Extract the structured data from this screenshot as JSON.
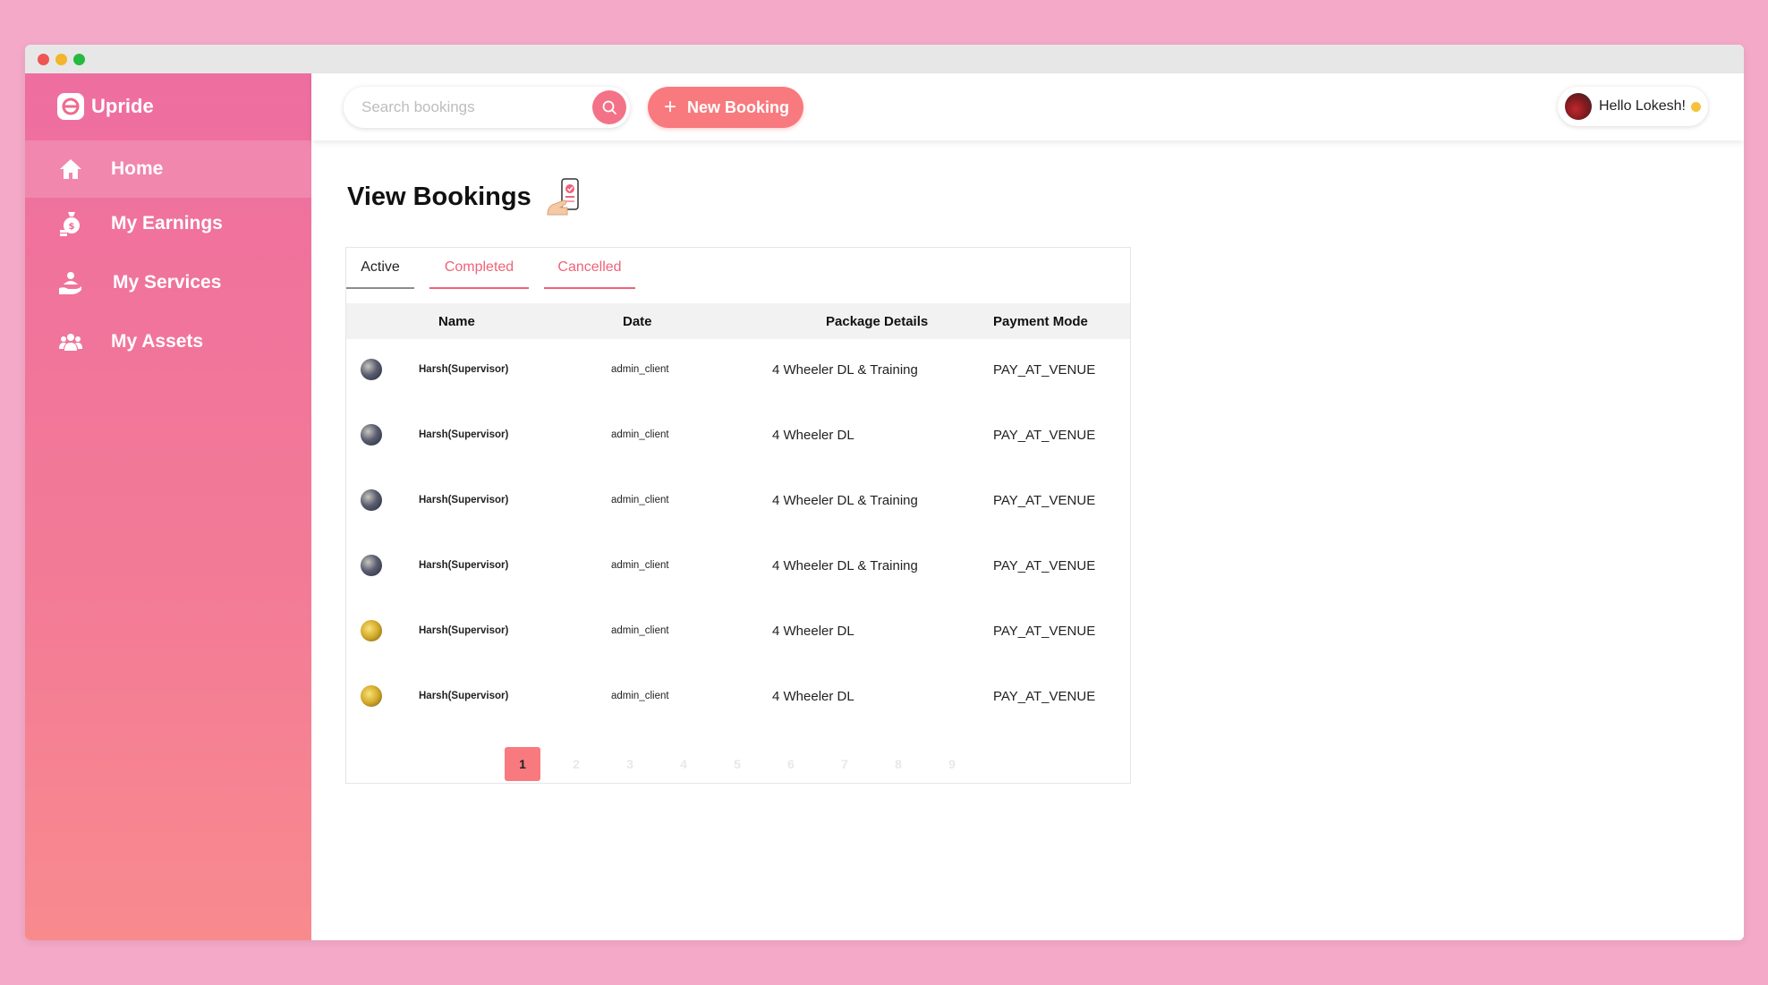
{
  "app": {
    "brand": "Upride"
  },
  "sidebar": {
    "items": [
      {
        "label": "Home",
        "icon": "home-icon",
        "active": true
      },
      {
        "label": "My Earnings",
        "icon": "money-bag-icon",
        "active": false
      },
      {
        "label": "My Services",
        "icon": "hand-service-icon",
        "active": false
      },
      {
        "label": "My Assets",
        "icon": "group-icon",
        "active": false
      }
    ]
  },
  "topbar": {
    "search_placeholder": "Search bookings",
    "new_booking_label": "New Booking",
    "greeting": "Hello Lokesh!"
  },
  "page": {
    "title": "View Bookings"
  },
  "tabs": [
    {
      "label": "Active",
      "active": true
    },
    {
      "label": "Completed",
      "active": false
    },
    {
      "label": "Cancelled",
      "active": false
    }
  ],
  "table": {
    "columns": [
      "Name",
      "Date",
      "Package Details",
      "Payment Mode"
    ],
    "rows": [
      {
        "avatar": "dark",
        "name": "Harsh(Supervisor)",
        "date": "admin_client",
        "package": "4 Wheeler DL & Training",
        "payment": "PAY_AT_VENUE"
      },
      {
        "avatar": "dark",
        "name": "Harsh(Supervisor)",
        "date": "admin_client",
        "package": "4 Wheeler DL",
        "payment": "PAY_AT_VENUE"
      },
      {
        "avatar": "dark",
        "name": "Harsh(Supervisor)",
        "date": "admin_client",
        "package": "4 Wheeler DL & Training",
        "payment": "PAY_AT_VENUE"
      },
      {
        "avatar": "dark",
        "name": "Harsh(Supervisor)",
        "date": "admin_client",
        "package": "4 Wheeler DL & Training",
        "payment": "PAY_AT_VENUE"
      },
      {
        "avatar": "gold",
        "name": "Harsh(Supervisor)",
        "date": "admin_client",
        "package": "4 Wheeler DL",
        "payment": "PAY_AT_VENUE"
      },
      {
        "avatar": "gold",
        "name": "Harsh(Supervisor)",
        "date": "admin_client",
        "package": "4 Wheeler DL",
        "payment": "PAY_AT_VENUE"
      }
    ]
  },
  "pagination": {
    "pages": [
      "1",
      "2",
      "3",
      "4",
      "5",
      "6",
      "7",
      "8",
      "9"
    ],
    "current": "1"
  },
  "colors": {
    "accent": "#f87a7e",
    "sidebar_top": "#ee6ea0",
    "tab_inactive": "#f06277"
  }
}
